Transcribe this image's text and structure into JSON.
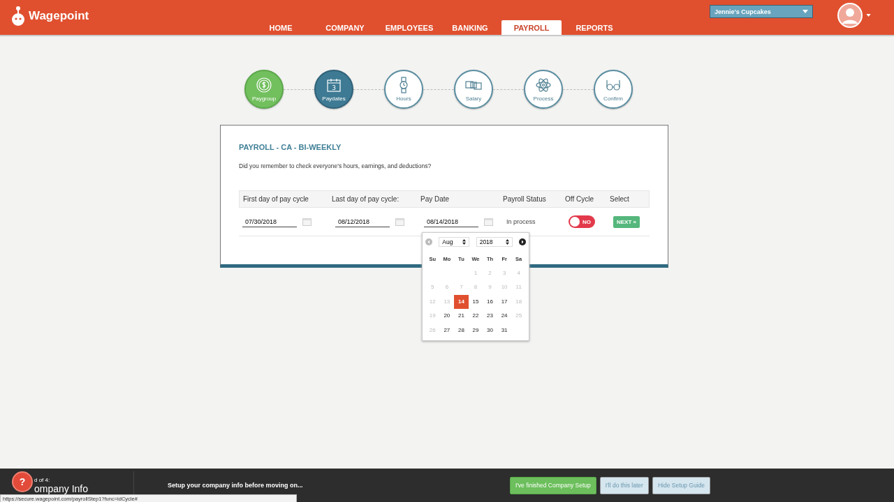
{
  "brand": {
    "name": "Wagepoint"
  },
  "nav": [
    {
      "label": "HOME",
      "selected": false
    },
    {
      "label": "COMPANY",
      "selected": false
    },
    {
      "label": "EMPLOYEES",
      "selected": false
    },
    {
      "label": "BANKING",
      "selected": false
    },
    {
      "label": "PAYROLL",
      "selected": true
    },
    {
      "label": "REPORTS",
      "selected": false
    }
  ],
  "company_select": {
    "value": "Jennie's Cupcakes"
  },
  "steps": [
    {
      "label": "Paygroup",
      "completed": true,
      "selected": false
    },
    {
      "label": "Paydates",
      "completed": false,
      "selected": true,
      "badge": "3"
    },
    {
      "label": "Hours",
      "completed": false,
      "selected": false
    },
    {
      "label": "Salary",
      "completed": false,
      "selected": false
    },
    {
      "label": "Process",
      "completed": false,
      "selected": false
    },
    {
      "label": "Confirm",
      "completed": false,
      "selected": false
    }
  ],
  "card": {
    "title": "PAYROLL - CA - BI-WEEKLY",
    "subtitle": "Did you remember to check everyone's hours, earnings, and deductions?",
    "columns": [
      "First day of pay cycle",
      "Last day of pay cycle:",
      "Pay Date",
      "Payroll Status",
      "Off Cycle",
      "Select"
    ],
    "row": {
      "first_day": "07/30/2018",
      "last_day": "08/12/2018",
      "pay_date": "08/14/2018",
      "status": "In process",
      "off_cycle": {
        "on": false,
        "label": "NO"
      },
      "next": "NEXT »"
    }
  },
  "datepicker": {
    "month": "Aug",
    "year": "2018",
    "weekdays": [
      "Su",
      "Mo",
      "Tu",
      "We",
      "Th",
      "Fr",
      "Sa"
    ],
    "weeks": [
      [
        {
          "day": "1",
          "disabled": true,
          "selected": false
        },
        {
          "day": "2",
          "disabled": true,
          "selected": false
        },
        {
          "day": "3",
          "disabled": true,
          "selected": false
        },
        {
          "day": "4",
          "disabled": true,
          "selected": false
        }
      ],
      [
        {
          "day": "5",
          "disabled": true,
          "selected": false
        },
        {
          "day": "6",
          "disabled": true,
          "selected": false
        },
        {
          "day": "7",
          "disabled": true,
          "selected": false
        },
        {
          "day": "8",
          "disabled": true,
          "selected": false
        },
        {
          "day": "9",
          "disabled": true,
          "selected": false
        },
        {
          "day": "10",
          "disabled": true,
          "selected": false
        },
        {
          "day": "11",
          "disabled": true,
          "selected": false
        }
      ],
      [
        {
          "day": "12",
          "disabled": true,
          "selected": false
        },
        {
          "day": "13",
          "disabled": true,
          "selected": false
        },
        {
          "day": "14",
          "disabled": false,
          "selected": true
        },
        {
          "day": "15",
          "disabled": false,
          "selected": false
        },
        {
          "day": "16",
          "disabled": false,
          "selected": false
        },
        {
          "day": "17",
          "disabled": false,
          "selected": false
        },
        {
          "day": "18",
          "disabled": true,
          "selected": false
        }
      ],
      [
        {
          "day": "19",
          "disabled": true,
          "selected": false
        },
        {
          "day": "20",
          "disabled": false,
          "selected": false
        },
        {
          "day": "21",
          "disabled": false,
          "selected": false
        },
        {
          "day": "22",
          "disabled": false,
          "selected": false
        },
        {
          "day": "23",
          "disabled": false,
          "selected": false
        },
        {
          "day": "24",
          "disabled": false,
          "selected": false
        },
        {
          "day": "25",
          "disabled": true,
          "selected": false
        }
      ],
      [
        {
          "day": "26",
          "disabled": true,
          "selected": false
        },
        {
          "day": "27",
          "disabled": false,
          "selected": false
        },
        {
          "day": "28",
          "disabled": false,
          "selected": false
        },
        {
          "day": "29",
          "disabled": false,
          "selected": false
        },
        {
          "day": "30",
          "disabled": false,
          "selected": false
        },
        {
          "day": "31",
          "disabled": false,
          "selected": false
        }
      ]
    ]
  },
  "setup_bar": {
    "help": "?",
    "step": "d of 4:",
    "title": "ompany Info",
    "message": "Setup your company info before moving on...",
    "buttons": [
      {
        "label": "I've finished Company Setup",
        "kind": "primary"
      },
      {
        "label": "I'll do this later",
        "kind": "secondary"
      },
      {
        "label": "Hide Setup Guide",
        "kind": "secondary"
      }
    ]
  },
  "status_url": "https://secure.wagepoint.com/payrollStep1?func=idCycle#"
}
